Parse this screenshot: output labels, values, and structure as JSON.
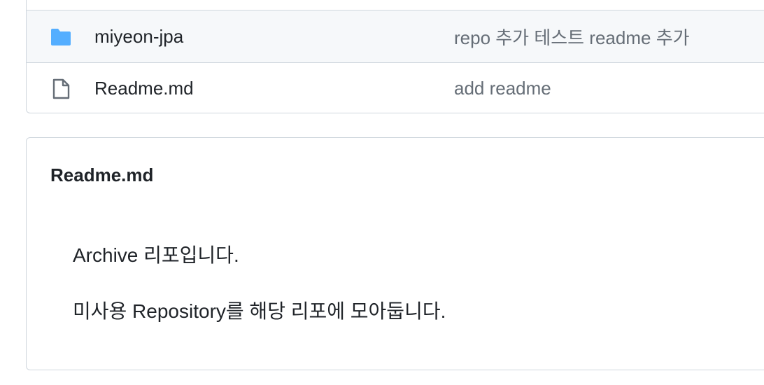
{
  "file_list": {
    "rows": [
      {
        "type": "folder",
        "icon": "folder-icon",
        "name": "miyeon-jpa",
        "commit_message": "repo 추가 테스트 readme 추가"
      },
      {
        "type": "file",
        "icon": "file-icon",
        "name": "Readme.md",
        "commit_message": "add readme"
      }
    ]
  },
  "readme": {
    "title": "Readme.md",
    "paragraphs": [
      "Archive 리포입니다.",
      "미사용 Repository를 해당 리포에 모아둡니다."
    ]
  },
  "colors": {
    "folder": "#54aeff",
    "file_icon": "#656d76",
    "muted_text": "#656d76",
    "border": "#d0d7de",
    "row_highlight": "#f6f8fa"
  }
}
